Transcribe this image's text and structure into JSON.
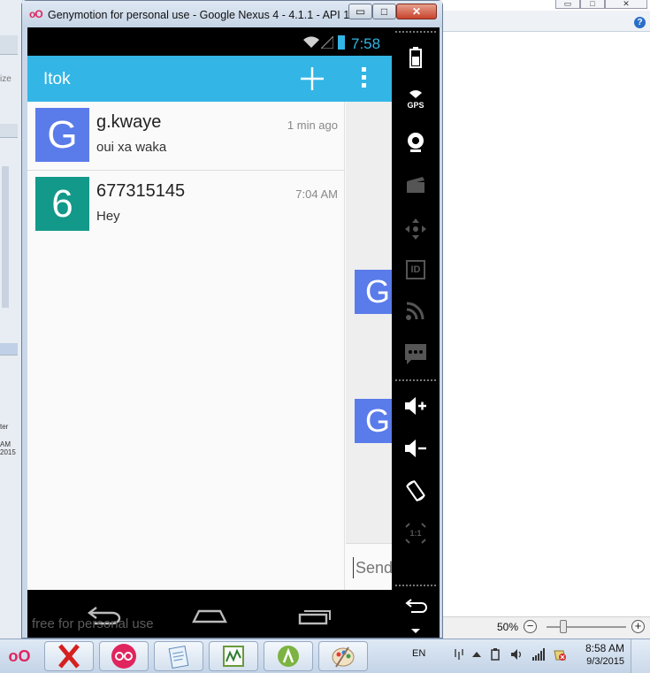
{
  "window": {
    "title": "Genymotion for personal use - Google Nexus 4 - 4.1.1 - API 1...",
    "logo": "oO",
    "minimize": "▭",
    "maximize": "□",
    "close": "✕"
  },
  "statusbar": {
    "time": "7:58"
  },
  "actionbar": {
    "title": "Itok"
  },
  "conversations": [
    {
      "avatar_letter": "G",
      "avatar_color": "#5a7bea",
      "name": "g.kwaye",
      "time": "1 min ago",
      "message": "oui xa waka"
    },
    {
      "avatar_letter": "6",
      "avatar_color": "#13998a",
      "name": "677315145",
      "time": "7:04 AM",
      "message": "Hey"
    }
  ],
  "chat": {
    "avatars": [
      "G",
      "G"
    ],
    "send_placeholder": "Send"
  },
  "navbar": {
    "watermark": "free for personal use"
  },
  "geny_sidebar": {
    "items": [
      "battery-icon",
      "gps-icon",
      "webcam-icon",
      "screencast-icon",
      "dpad-icon",
      "device-id-icon",
      "network-icon",
      "sms-icon",
      "volume-up-icon",
      "volume-down-icon",
      "rotate-icon",
      "pixel-perfect-icon",
      "back-icon"
    ],
    "gps_label": "GPS",
    "id_label": "ID",
    "pixel_label": "1:1"
  },
  "background_app": {
    "zoom_level": "50%",
    "zoom_minus": "−",
    "zoom_plus": "+",
    "help": "?",
    "left_fragments": [
      "ize",
      "AM",
      "2015",
      "ter"
    ]
  },
  "taskbar": {
    "start_label": "oO",
    "language": "EN",
    "time": "8:58 AM",
    "date": "9/3/2015"
  },
  "colors": {
    "accent": "#33b5e5",
    "actionbar": "#33b5e5",
    "avatar_blue": "#5a7bea",
    "avatar_teal": "#13998a"
  }
}
